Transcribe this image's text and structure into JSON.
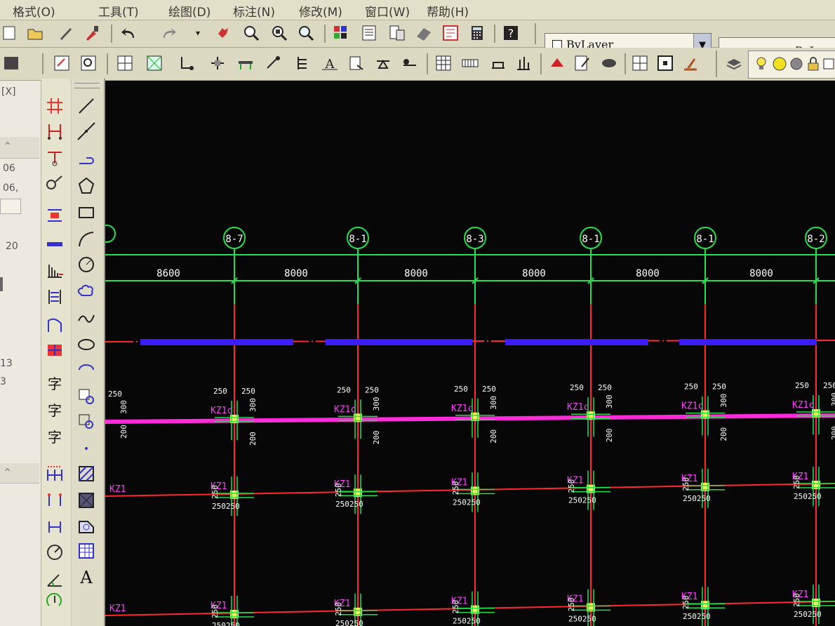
{
  "menubar": {
    "items": [
      "格式(O)",
      "工具(T)",
      "绘图(D)",
      "标注(N)",
      "修改(M)",
      "窗口(W)",
      "帮助(H)"
    ]
  },
  "properties": {
    "color_control": "ByLayer",
    "linetype_control": "ByLayer"
  },
  "left_panel": {
    "fragments": [
      "[X]",
      "06",
      "06,",
      "20",
      "13",
      "3"
    ]
  },
  "palette_text": {
    "text_tool_1": "字",
    "text_tool_2": "字",
    "text_tool_3": "字",
    "mtext_tool": "A"
  },
  "drawing": {
    "axis_bubbles": [
      "8-7",
      "8-1",
      "8-3",
      "8-1",
      "8-1",
      "8-2"
    ],
    "bay_dimensions": [
      "8600",
      "8000",
      "8000",
      "8000",
      "8000",
      "8000"
    ],
    "column_label_row1": "KZ1c",
    "column_label": "KZ1",
    "dim_250": "250",
    "dim_300": "300",
    "dim_200": "200",
    "dim_250250": "250250",
    "colors": {
      "background": "#070708",
      "axis_green": "#22e04a",
      "grid_red": "#ff2a2a",
      "beam_blue": "#3a1cff",
      "beam_magenta": "#ff2ad8",
      "column_yellow": "#f2f05a",
      "label_magenta": "#ff3cff",
      "dim_white": "#ffffff"
    }
  }
}
